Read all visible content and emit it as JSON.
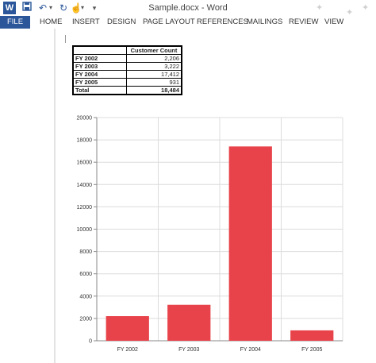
{
  "app": {
    "title": "Sample.docx - Word",
    "icon": "word-icon",
    "quick_access": [
      "save-icon",
      "undo-icon",
      "redo-icon",
      "touch-mode-icon"
    ]
  },
  "ribbon": {
    "tabs": [
      "FILE",
      "HOME",
      "INSERT",
      "DESIGN",
      "PAGE LAYOUT",
      "REFERENCES",
      "MAILINGS",
      "REVIEW",
      "VIEW"
    ],
    "active_tab": "FILE"
  },
  "colors": {
    "accent": "#2b579a",
    "bar": "#e8434b"
  },
  "table": {
    "header": "Customer Count",
    "rows": [
      {
        "label": "FY 2002",
        "value": "2,206"
      },
      {
        "label": "FY 2003",
        "value": "3,222"
      },
      {
        "label": "FY 2004",
        "value": "17,412"
      },
      {
        "label": "FY 2005",
        "value": "931"
      }
    ],
    "total": {
      "label": "Total",
      "value": "18,484"
    }
  },
  "chart_data": {
    "type": "bar",
    "categories": [
      "FY 2002",
      "FY 2003",
      "FY 2004",
      "FY 2005"
    ],
    "values": [
      2206,
      3222,
      17412,
      931
    ],
    "ylim": [
      0,
      20000
    ],
    "yticks": [
      "0",
      "2000",
      "4000",
      "6000",
      "8000",
      "10000",
      "12000",
      "14000",
      "16000",
      "18000",
      "20000"
    ],
    "grid": true,
    "legend": "none"
  }
}
